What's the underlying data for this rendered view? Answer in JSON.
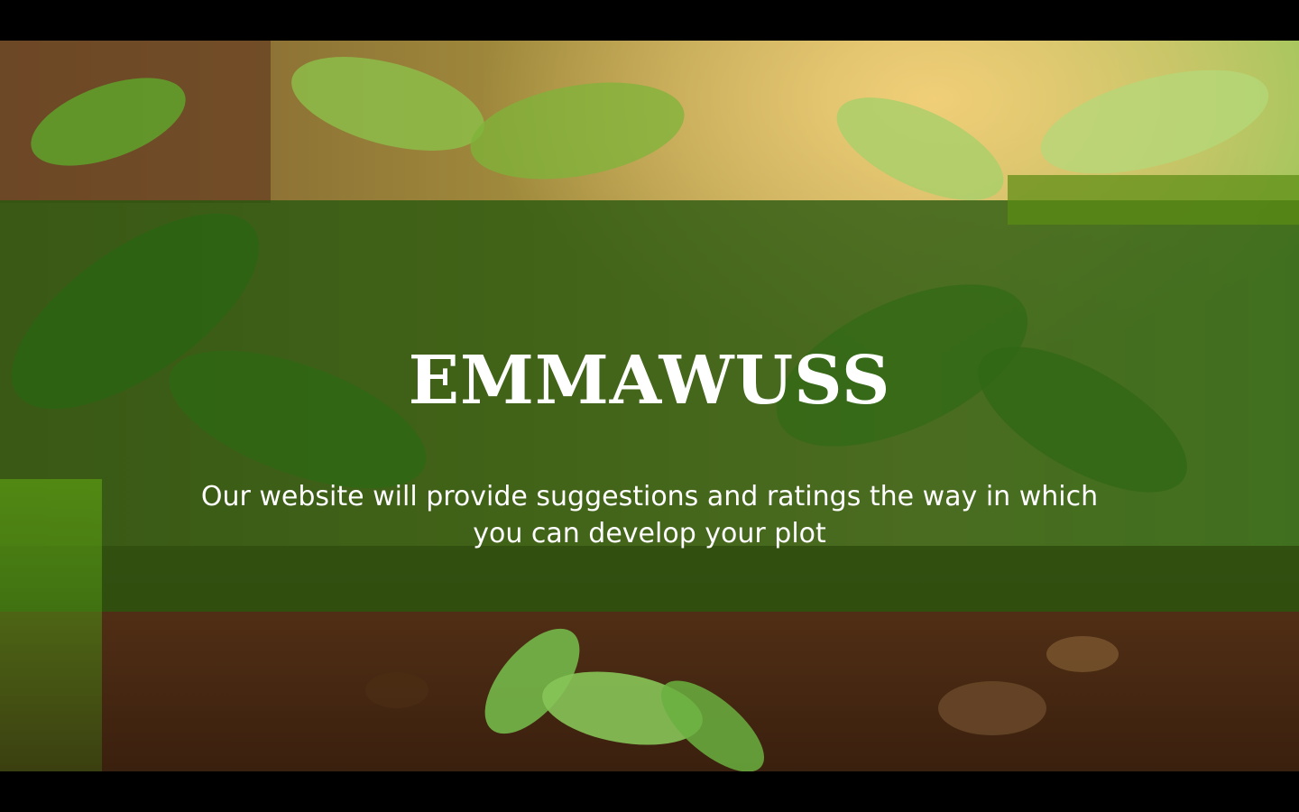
{
  "hero": {
    "title": "EMMAWUSS",
    "tagline": "Our website will provide suggestions and ratings the way in which you can develop your plot",
    "background_image": "garden-seedlings-in-soil-photo"
  },
  "colors": {
    "band_overlay": "#26580e",
    "accent": "#5c8c14",
    "letterbox": "#000000",
    "text": "#ffffff"
  }
}
